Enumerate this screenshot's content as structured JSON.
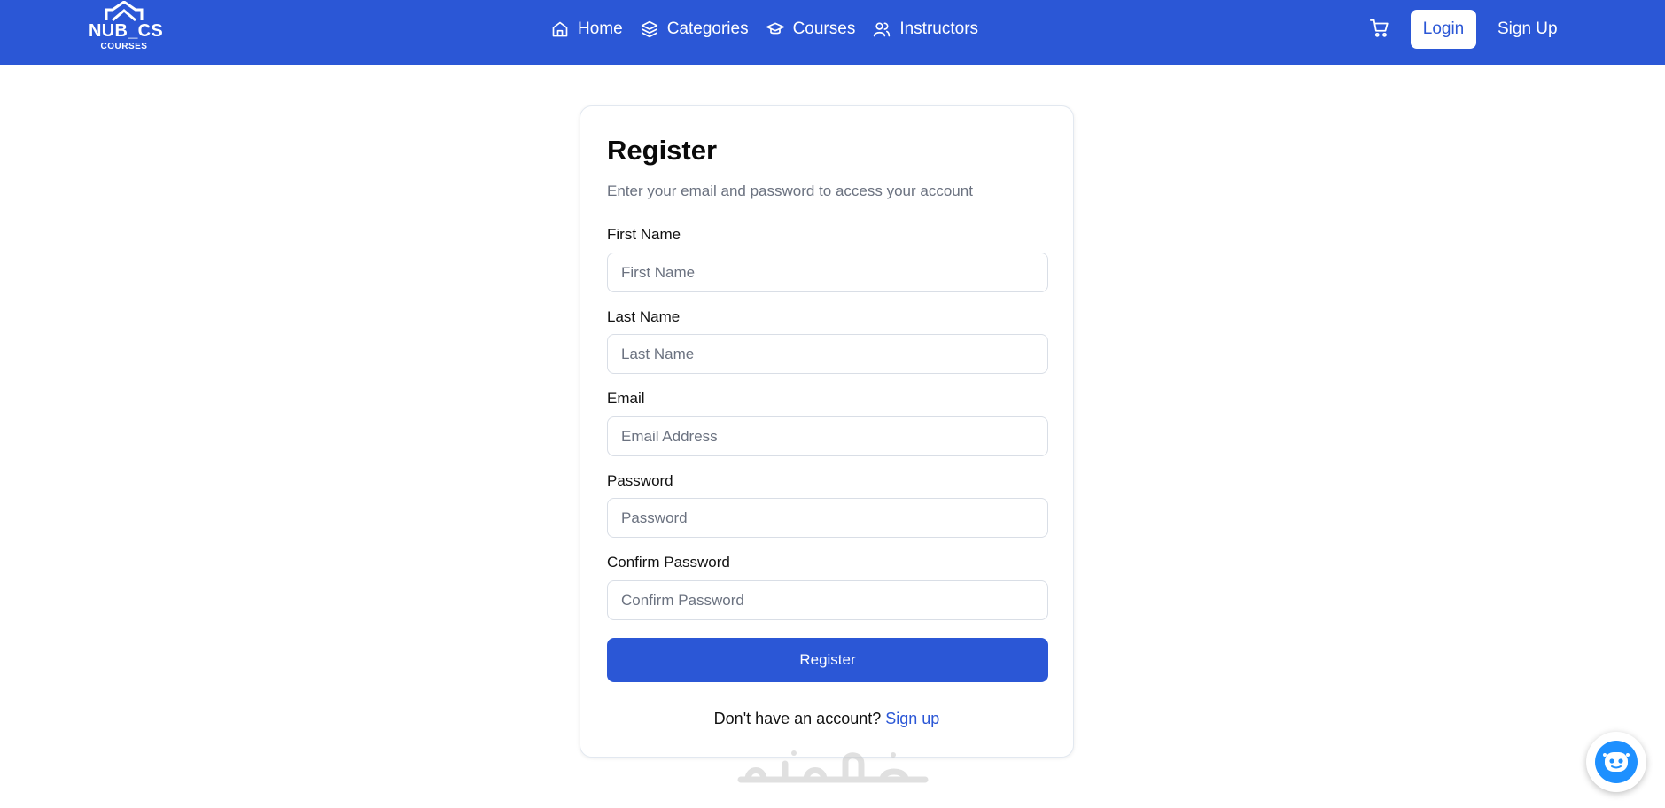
{
  "header": {
    "logo": {
      "name": "NUB_CS",
      "sub": "COURSES"
    },
    "nav": [
      {
        "label": "Home",
        "icon": "home-icon"
      },
      {
        "label": "Categories",
        "icon": "layers-icon"
      },
      {
        "label": "Courses",
        "icon": "graduation-cap-icon"
      },
      {
        "label": "Instructors",
        "icon": "users-icon"
      }
    ],
    "cart_icon": "cart-icon",
    "login_label": "Login",
    "signup_label": "Sign Up"
  },
  "form": {
    "title": "Register",
    "subtitle": "Enter your email and password to access your account",
    "fields": [
      {
        "label": "First Name",
        "placeholder": "First Name",
        "value": ""
      },
      {
        "label": "Last Name",
        "placeholder": "Last Name",
        "value": ""
      },
      {
        "label": "Email",
        "placeholder": "Email Address",
        "value": ""
      },
      {
        "label": "Password",
        "placeholder": "Password",
        "value": ""
      },
      {
        "label": "Confirm Password",
        "placeholder": "Confirm Password",
        "value": ""
      }
    ],
    "submit_label": "Register",
    "footer_text": "Don't have an account?",
    "footer_link": "Sign up"
  },
  "watermark_text": "خمسات",
  "chatbot_icon": "chatbot-icon",
  "colors": {
    "primary": "#2b57d6",
    "chatbot": "#1e90ff"
  }
}
